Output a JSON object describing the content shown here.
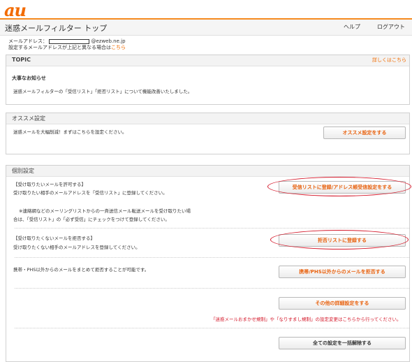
{
  "header": {
    "logo": "au",
    "title": "迷惑メールフィルター トップ",
    "help": "ヘルプ",
    "logout": "ログアウト"
  },
  "account": {
    "mail_label": "メールアドレス：",
    "domain": "@ezweb.ne.jp",
    "note": "設定するメールアドレスが上記と異なる場合は",
    "note_link": "こちら"
  },
  "topic": {
    "heading": "TOPIC",
    "more_link": "詳しくはこちら",
    "news_title": "大事なお知らせ",
    "news_body": "迷惑メールフィルターの「受信リスト」「拒否リスト」について機能改善いたしました。"
  },
  "recommend": {
    "heading": "オススメ設定",
    "text": "迷惑メールを大幅削減！まずはこちらを設定ください。",
    "button": "オススメ設定をする"
  },
  "individual": {
    "heading": "個別設定",
    "allow": {
      "title": "【受け取りたいメールを許可する】",
      "desc": "受け取りたい相手のメールアドレスを「受信リスト」に登録してください。",
      "note1": "※連絡網などのメーリングリストからの一斉送信メール転送メールを受け取りたい場",
      "note2": "合は、「受信リスト」の「必ず受信」にチェックをつけて登録してください。",
      "button": "受信リストに登録/アドレス帳受信設定をする"
    },
    "reject": {
      "title": "【受け取りたくないメールを拒否する】",
      "desc": "受け取りたくない相手のメールアドレスを登録してください。",
      "button": "拒否リストに登録する"
    },
    "mobile": {
      "desc": "携帯・PHS以外からのメールをまとめて拒否することが可能です。",
      "button": "携帯/PHS以外からのメールを拒否する"
    },
    "other": {
      "button": "その他の詳細設定をする",
      "note": "「迷惑メールおまかせ規制」や「なりすまし規制」の設定変更はこちらから行ってください。"
    },
    "reset": {
      "button": "全ての設定を一括解除する"
    }
  },
  "colors": {
    "accent": "#f26b00",
    "annotation": "#d4182a"
  }
}
